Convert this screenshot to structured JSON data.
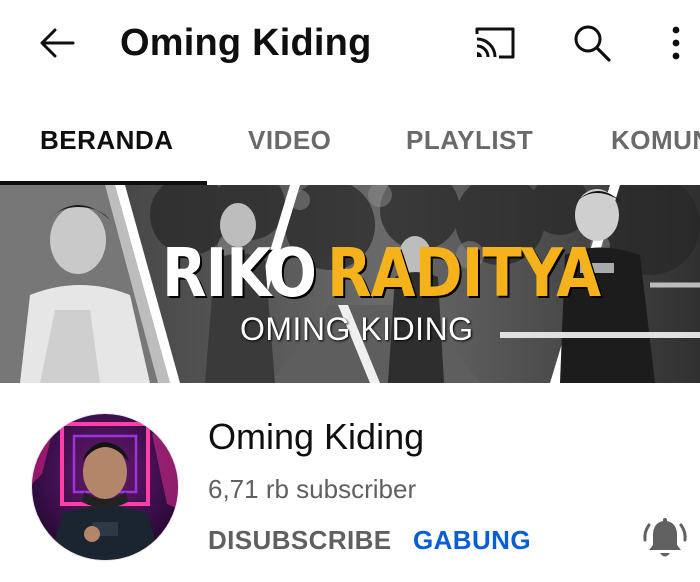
{
  "appbar": {
    "title": "Oming Kiding",
    "back_icon": "arrow-left-icon",
    "cast_icon": "cast-icon",
    "search_icon": "search-icon",
    "more_icon": "more-vert-icon"
  },
  "tabs": [
    {
      "label": "BERANDA",
      "active": true
    },
    {
      "label": "VIDEO",
      "active": false
    },
    {
      "label": "PLAYLIST",
      "active": false
    },
    {
      "label": "KOMUN",
      "active": false
    }
  ],
  "banner": {
    "name_part1": "RIKO",
    "name_part2": "RADITYA",
    "subtitle": "OMING KIDING",
    "accent_color": "#f6b21b"
  },
  "channel": {
    "name": "Oming Kiding",
    "subscribers": "6,71 rb subscriber",
    "unsubscribe_label": "DISUBSCRIBE",
    "join_label": "GABUNG",
    "notification_icon": "bell-ringing-icon"
  },
  "colors": {
    "text_primary": "#0f0f0f",
    "text_secondary": "#606060",
    "link_blue": "#065fd4"
  }
}
